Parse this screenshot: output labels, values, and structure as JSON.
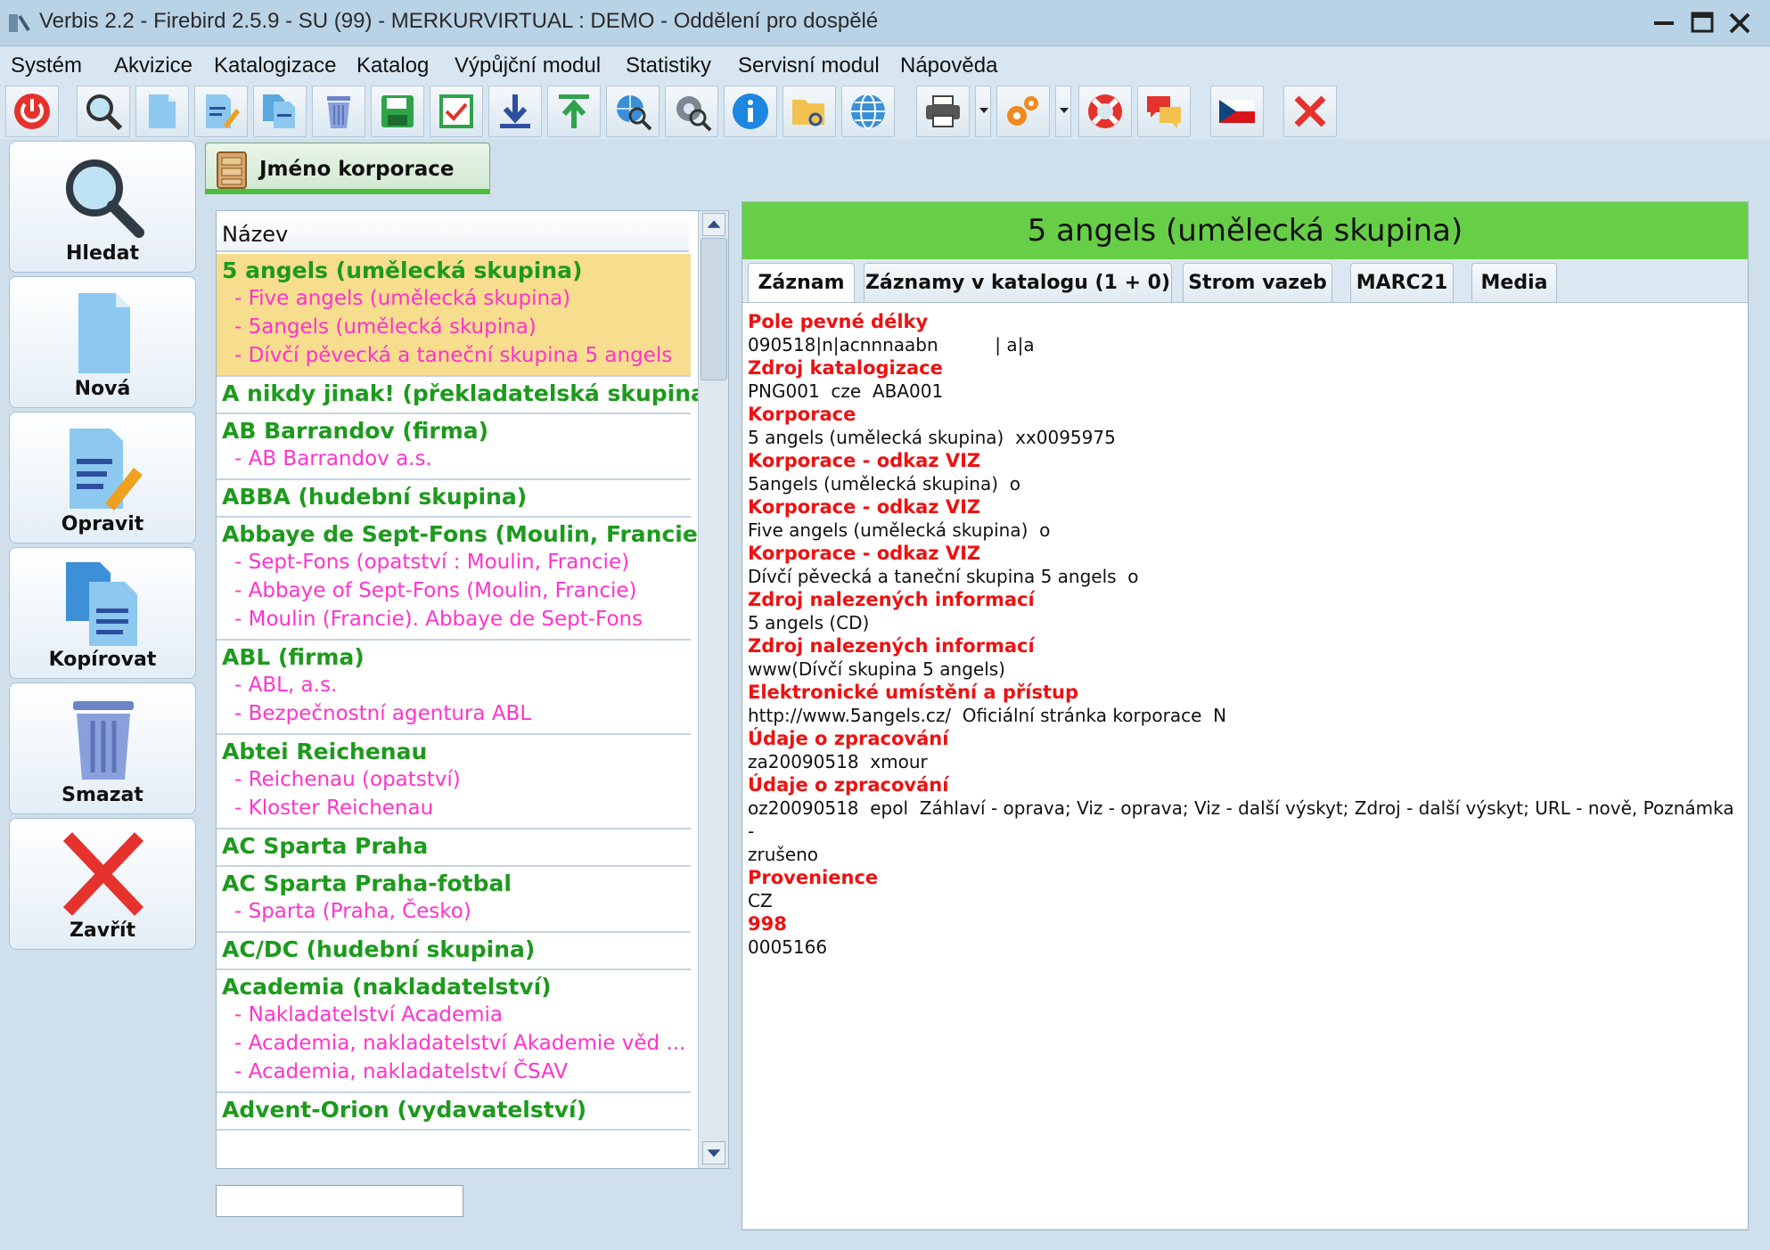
{
  "window": {
    "title": "Verbis 2.2 - Firebird 2.5.9 - SU (99) - MERKURVIRTUAL : DEMO - Oddělení pro dospělé"
  },
  "menu": [
    "Systém",
    "Akvizice",
    "Katalogizace",
    "Katalog",
    "Výpůjční modul",
    "Statistiky",
    "Servisní modul",
    "Nápověda"
  ],
  "toolbar_icons": [
    "power-icon",
    "search-icon",
    "new-document-icon",
    "edit-document-icon",
    "copy-document-icon",
    "trash-icon",
    "save-icon",
    "checkbox-icon",
    "import-icon",
    "export-icon",
    "web-search-icon",
    "settings-search-icon",
    "info-icon",
    "folder-link-icon",
    "globe-icon",
    "printer-icon",
    "gears-icon",
    "lifebuoy-icon",
    "chat-icon",
    "czech-flag-icon",
    "close-icon"
  ],
  "side_buttons": {
    "search": "Hledat",
    "new": "Nová",
    "edit": "Opravit",
    "copy": "Kopírovat",
    "delete": "Smazat",
    "close": "Zavřít"
  },
  "tab": {
    "label": "Jméno korporace"
  },
  "list": {
    "header": "Název",
    "entries": [
      {
        "main": "5 angels (umělecká skupina)",
        "subs": [
          "- Five angels (umělecká skupina)",
          "- 5angels (umělecká skupina)",
          "- Dívčí pěvecká a taneční skupina 5 angels"
        ],
        "selected": true
      },
      {
        "main": "A nikdy jinak! (překladatelská skupina)",
        "subs": []
      },
      {
        "main": "AB Barrandov (firma)",
        "subs": [
          "- AB Barrandov a.s."
        ]
      },
      {
        "main": "ABBA (hudební skupina)",
        "subs": []
      },
      {
        "main": "Abbaye de Sept-Fons (Moulin, Francie)",
        "subs": [
          "- Sept-Fons (opatství : Moulin, Francie)",
          "- Abbaye of Sept-Fons (Moulin, Francie)",
          "- Moulin (Francie). Abbaye de Sept-Fons"
        ]
      },
      {
        "main": "ABL (firma)",
        "subs": [
          "- ABL, a.s.",
          "- Bezpečnostní agentura ABL"
        ]
      },
      {
        "main": "Abtei Reichenau",
        "subs": [
          "- Reichenau (opatství)",
          "- Kloster Reichenau"
        ]
      },
      {
        "main": "AC Sparta Praha",
        "subs": []
      },
      {
        "main": "AC Sparta Praha-fotbal",
        "subs": [
          "- Sparta (Praha, Česko)"
        ]
      },
      {
        "main": "AC/DC (hudební skupina)",
        "subs": []
      },
      {
        "main": "Academia (nakladatelství)",
        "subs": [
          "- Nakladatelství Academia",
          "- Academia, nakladatelství Akademie věd ...",
          "- Academia, nakladatelství ČSAV"
        ]
      },
      {
        "main": "Advent-Orion (vydavatelství)",
        "subs": []
      }
    ],
    "search_value": ""
  },
  "detail": {
    "title": "5 angels (umělecká skupina)",
    "tabs": [
      "Záznam",
      "Záznamy v katalogu (1 + 0)",
      "Strom vazeb",
      "MARC21",
      "Media"
    ],
    "active_tab": "Záznam",
    "fields": [
      {
        "label": "Pole pevné délky",
        "value": "090518|n|acnnnaabn          | a|a"
      },
      {
        "label": "Zdroj katalogizace",
        "value": "PNG001  cze  ABA001"
      },
      {
        "label": "Korporace",
        "value": "5 angels (umělecká skupina)  xx0095975"
      },
      {
        "label": "Korporace - odkaz VIZ",
        "value": "5angels (umělecká skupina)  o"
      },
      {
        "label": "Korporace - odkaz VIZ",
        "value": "Five angels (umělecká skupina)  o"
      },
      {
        "label": "Korporace - odkaz VIZ",
        "value": "Dívčí pěvecká a taneční skupina 5 angels  o"
      },
      {
        "label": "Zdroj nalezených informací",
        "value": "5 angels (CD)"
      },
      {
        "label": "Zdroj nalezených informací",
        "value": "www(Dívčí skupina 5 angels)"
      },
      {
        "label": "Elektronické umístění a přístup",
        "value": "http://www.5angels.cz/  Oficiální stránka korporace  N"
      },
      {
        "label": "Údaje o zpracování",
        "value": "za20090518  xmour"
      },
      {
        "label": "Údaje o zpracování",
        "value": "oz20090518  epol  Záhlaví - oprava; Viz - oprava; Viz - další výskyt; Zdroj - další výskyt; URL - nově, Poznámka -\nzrušeno"
      },
      {
        "label": "Provenience",
        "value": "CZ"
      },
      {
        "label": "998",
        "value": "0005166"
      }
    ]
  },
  "colors": {
    "accent_green": "#67cf47",
    "entry_main": "#1c9a1c",
    "entry_sub": "#ff33cc",
    "field_label": "#ee1111",
    "selected_row": "#f7dd8e"
  }
}
